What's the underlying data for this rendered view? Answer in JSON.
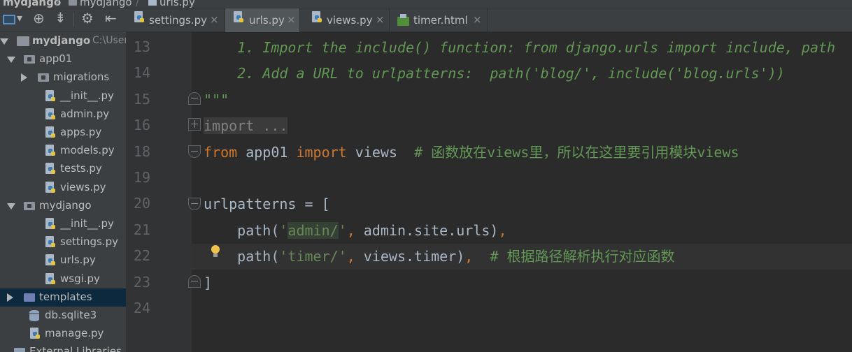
{
  "breadcrumb": {
    "items": [
      "mydjango",
      "mydjango",
      "urls.py"
    ]
  },
  "project_panel": {
    "toolbar": {
      "view_icon": "project-view-icon",
      "locate_icon": "target-icon",
      "collapse_icon": "collapse-icon",
      "settings_icon": "gear-icon",
      "hide_icon": "minimize-icon"
    },
    "tree": [
      {
        "label": "mydjango",
        "hint": "C:\\Users\\",
        "type": "folder",
        "expanded": true,
        "bold": true
      },
      {
        "label": "app01",
        "type": "package",
        "expanded": true
      },
      {
        "label": "migrations",
        "type": "package",
        "expanded": false
      },
      {
        "label": "__init__.py",
        "type": "python"
      },
      {
        "label": "admin.py",
        "type": "python"
      },
      {
        "label": "apps.py",
        "type": "python"
      },
      {
        "label": "models.py",
        "type": "python"
      },
      {
        "label": "tests.py",
        "type": "python"
      },
      {
        "label": "views.py",
        "type": "python"
      },
      {
        "label": "mydjango",
        "type": "package",
        "expanded": true
      },
      {
        "label": "__init__.py",
        "type": "python"
      },
      {
        "label": "settings.py",
        "type": "python"
      },
      {
        "label": "urls.py",
        "type": "python"
      },
      {
        "label": "wsgi.py",
        "type": "python"
      },
      {
        "label": "templates",
        "type": "folder",
        "expanded": false,
        "selected": true
      },
      {
        "label": "db.sqlite3",
        "type": "database"
      },
      {
        "label": "manage.py",
        "type": "python"
      },
      {
        "label": "External Libraries",
        "type": "library"
      }
    ]
  },
  "tabs": [
    {
      "label": "settings.py",
      "icon": "python-file-icon",
      "close": "×"
    },
    {
      "label": "urls.py",
      "icon": "python-file-icon",
      "close": "×",
      "active": true
    },
    {
      "label": "views.py",
      "icon": "python-file-icon",
      "close": "×"
    },
    {
      "label": "timer.html",
      "icon": "html-file-icon",
      "close": "×"
    }
  ],
  "editor": {
    "lines": [
      {
        "num": "13",
        "parts": [
          [
            "doc",
            "    1. Import the include() function: from django.urls import include, path"
          ]
        ]
      },
      {
        "num": "14",
        "parts": [
          [
            "doc",
            "    2. Add a URL to urlpatterns:  path('blog/', include('blog.urls'))"
          ]
        ]
      },
      {
        "num": "15",
        "parts": [
          [
            "doc",
            "\"\"\""
          ]
        ]
      },
      {
        "num": "16",
        "parts": [
          [
            "fold-box",
            "import ..."
          ]
        ]
      },
      {
        "num": "18",
        "parts": [
          [
            "kw",
            "from"
          ],
          [
            "",
            " app01 "
          ],
          [
            "kw",
            "import"
          ],
          [
            "",
            " views  "
          ],
          [
            "cm",
            "# 函数放在views里，所以在这里要引用模块views"
          ]
        ]
      },
      {
        "num": "19",
        "parts": []
      },
      {
        "num": "20",
        "parts": [
          [
            "",
            "urlpatterns = ["
          ]
        ]
      },
      {
        "num": "21",
        "parts": [
          [
            "",
            "    path("
          ],
          [
            "str",
            "'"
          ],
          [
            "str hl",
            "admin/"
          ],
          [
            "str",
            "'"
          ],
          [
            "kw",
            ","
          ],
          [
            "",
            " admin.site.urls"
          ],
          [
            "",
            ")"
          ],
          [
            "kw",
            ","
          ]
        ]
      },
      {
        "num": "22",
        "parts": [
          [
            "",
            "    path("
          ],
          [
            "str",
            "'timer/'"
          ],
          [
            "kw",
            ","
          ],
          [
            "",
            " views.timer)"
          ],
          [
            "kw",
            ","
          ],
          [
            "",
            "  "
          ],
          [
            "cm",
            "# 根据路径解析执行对应函数"
          ]
        ]
      },
      {
        "num": "23",
        "parts": [
          [
            "",
            "]"
          ]
        ]
      },
      {
        "num": "24",
        "parts": []
      }
    ]
  }
}
